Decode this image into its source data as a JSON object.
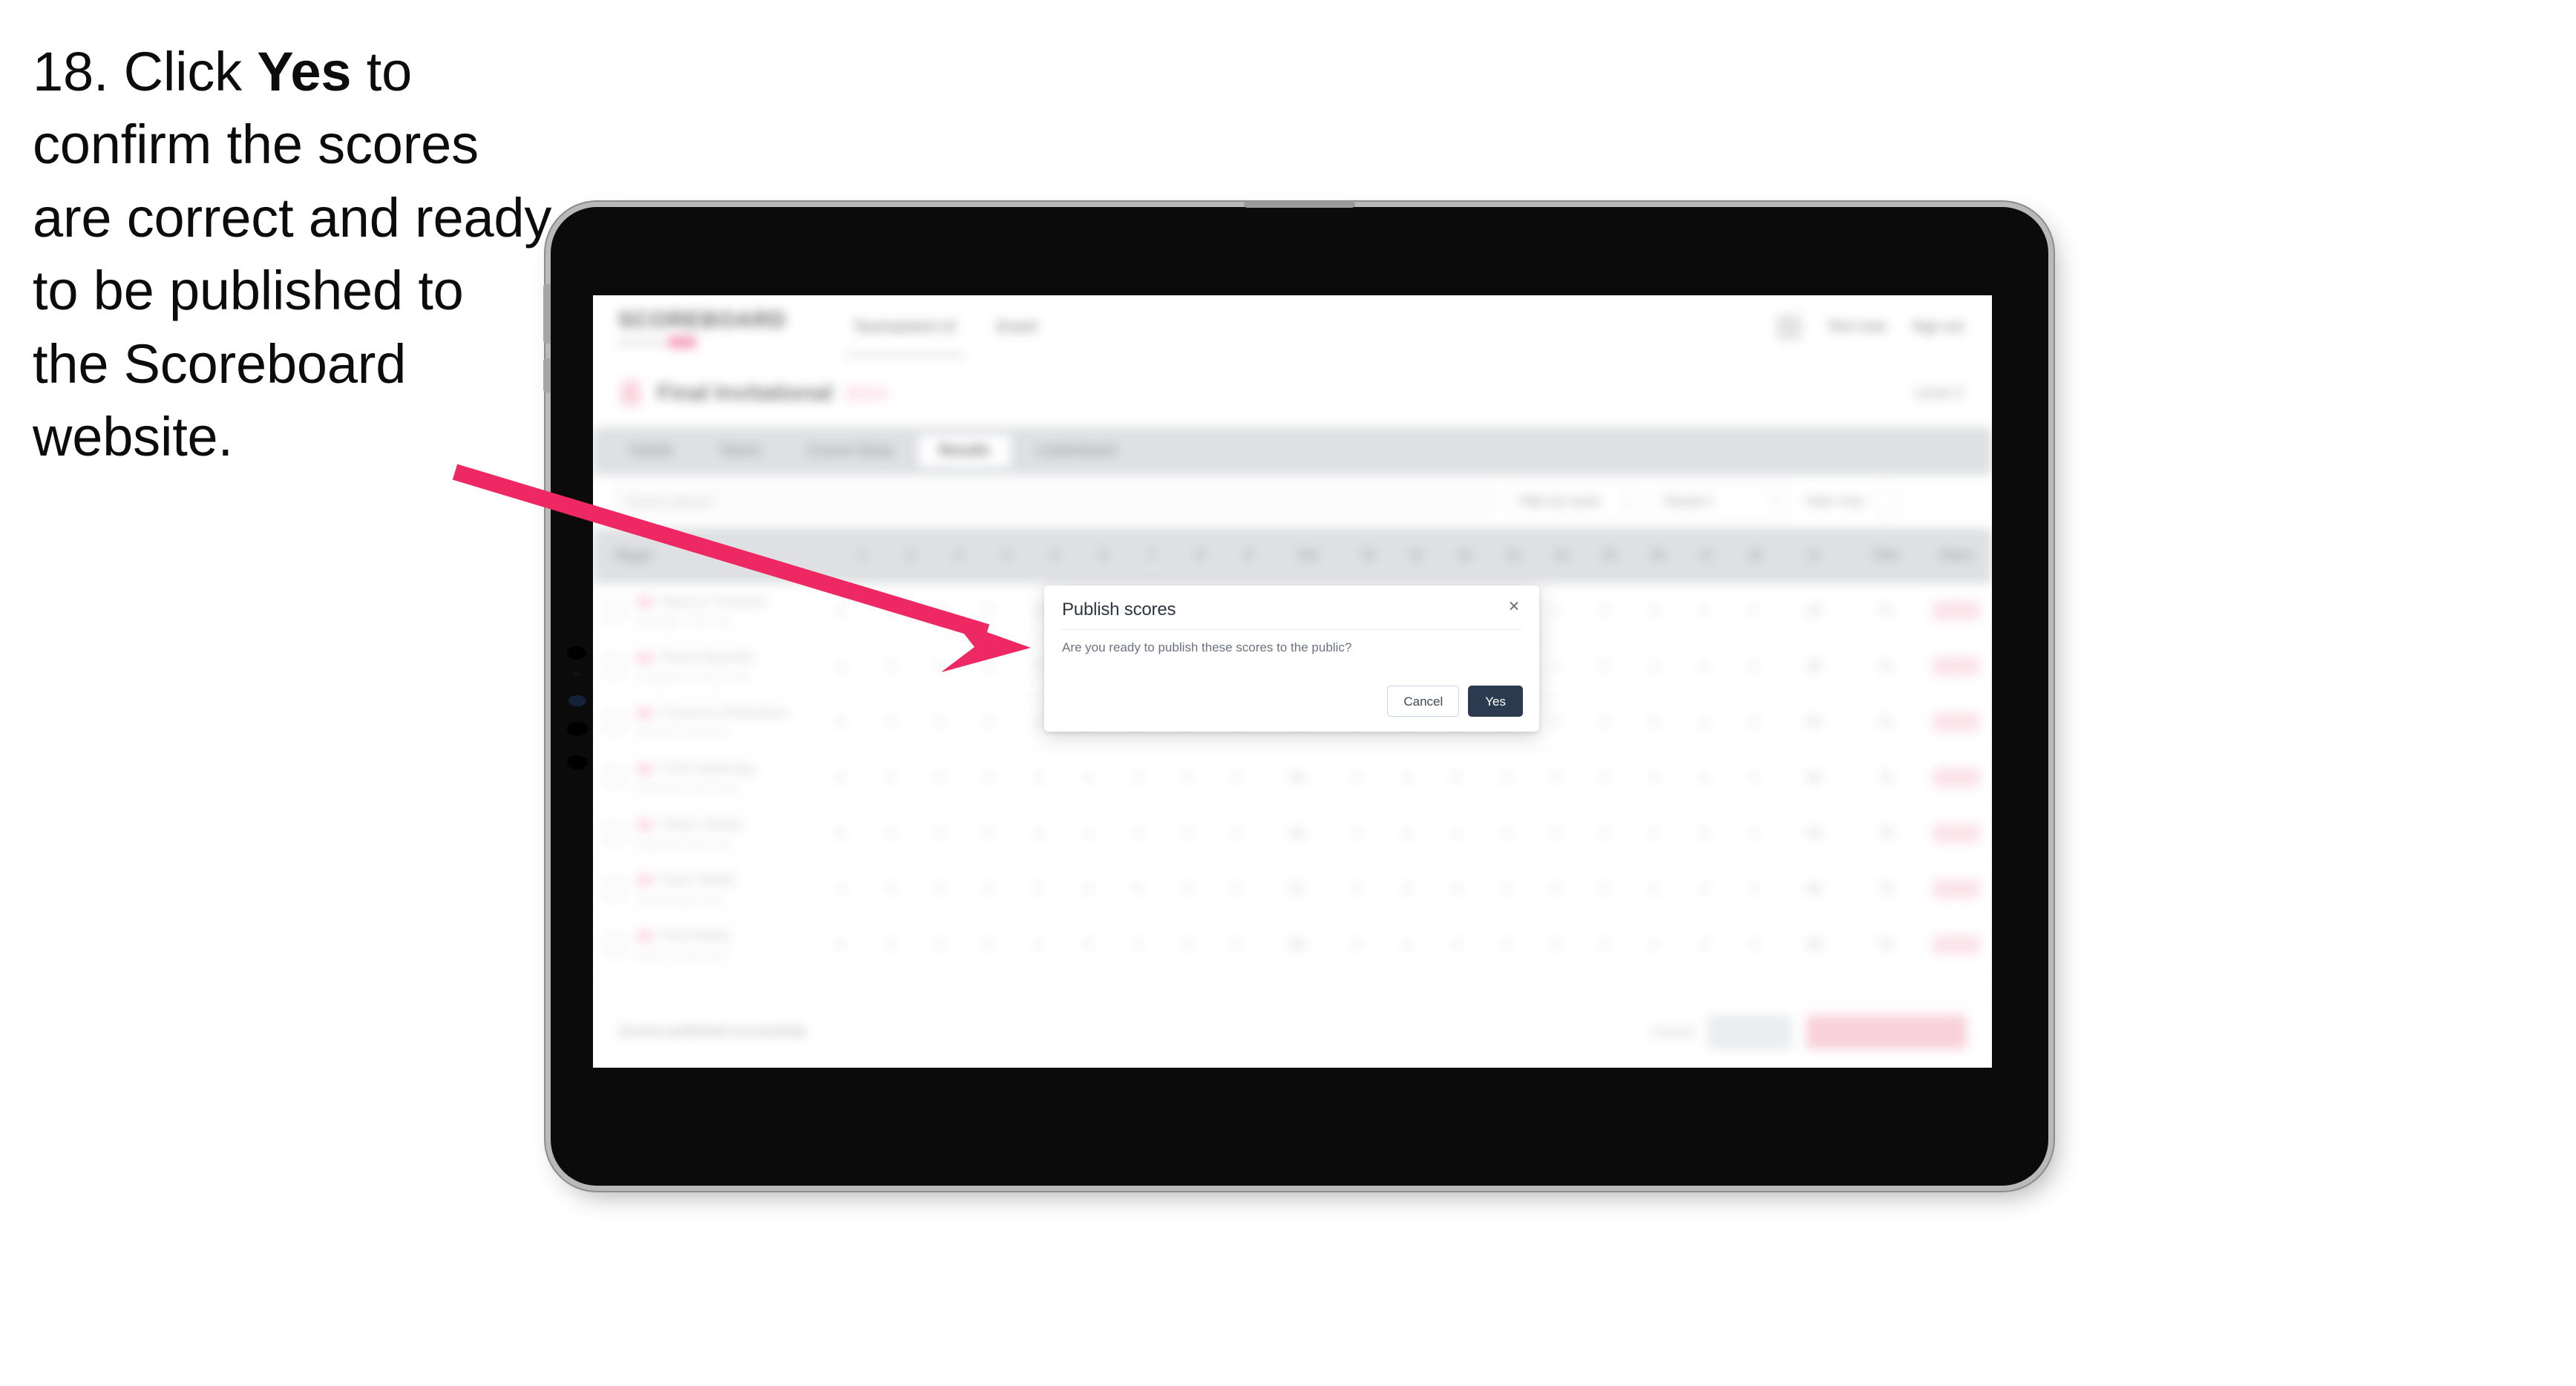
{
  "instruction": {
    "number": "18.",
    "text_before": "Click ",
    "emphasis": "Yes",
    "text_after": " to confirm the scores are correct and ready to be published to the Scoreboard website."
  },
  "colors": {
    "arrow": "#ee2862",
    "primary_button": "#2b3a4f",
    "brand_pink": "#f06292",
    "tab_bar": "#d6d8dc",
    "device_bezel": "#0b0b0b",
    "device_edge": "#b9b9b9"
  },
  "device": {
    "kind": "tablet",
    "orientation": "landscape",
    "keys": [
      "volume-up-key",
      "volume-down-key"
    ]
  },
  "app": {
    "topbar": {
      "logo": "SCOREBOARD",
      "logo_sub": "powered by",
      "logo_pill": "LIVE",
      "nav": [
        {
          "label": "Tournament UI",
          "active": true
        },
        {
          "label": "Event",
          "active": false
        }
      ],
      "right": [
        {
          "label": "Test User",
          "name": "user-menu"
        },
        {
          "label": "Sign out",
          "name": "sign-out-link"
        }
      ]
    },
    "heading": {
      "title": "Final Invitational",
      "year": "2024",
      "right": "Level 3"
    },
    "tabs": [
      {
        "label": "Details",
        "active": false
      },
      {
        "label": "Teams",
        "active": false
      },
      {
        "label": "Course Setup",
        "active": false
      },
      {
        "label": "Results",
        "active": true
      },
      {
        "label": "Leaderboard",
        "active": false
      }
    ],
    "filterbar": {
      "search_placeholder": "Search players",
      "selects": [
        {
          "label": "Filter by round",
          "name": "round-filter-select"
        },
        {
          "label": "Round 1",
          "name": "round-select"
        }
      ],
      "right_text": "Table Only",
      "icon": "columns-icon"
    },
    "table": {
      "columns": [
        "Player",
        "1",
        "2",
        "3",
        "4",
        "5",
        "6",
        "7",
        "8",
        "9",
        "Out",
        "10",
        "11",
        "12",
        "13",
        "14",
        "15",
        "16",
        "17",
        "18",
        "In",
        "Total",
        "Status"
      ],
      "rows": [
        {
          "player": "Marcus Thomton",
          "club": "Oakridge Golf Club",
          "out": "36",
          "in": "35",
          "total": "71",
          "status": "Verified"
        },
        {
          "player": "Elena Reynold",
          "club": "Lakeside Country Club",
          "out": "35",
          "in": "36",
          "total": "71",
          "status": "Verified"
        },
        {
          "player": "Cameron Robertson",
          "club": "Pinehurst National",
          "out": "37",
          "in": "34",
          "total": "71",
          "status": "Verified"
        },
        {
          "player": "Chris Mahoney",
          "club": "Riverbend Golf Links",
          "out": "36",
          "in": "36",
          "total": "72",
          "status": "Verified"
        },
        {
          "player": "Oliver Obrien",
          "club": "Highland Park Golf",
          "out": "38",
          "in": "35",
          "total": "73",
          "status": "Verified"
        },
        {
          "player": "Ryan Webb",
          "club": "Stonebridge Club",
          "out": "37",
          "in": "36",
          "total": "73",
          "status": "Verified"
        },
        {
          "player": "Nick Bailey",
          "club": "Willow Creek Golf",
          "out": "38",
          "in": "36",
          "total": "74",
          "status": "Verified"
        }
      ]
    },
    "actionbar": {
      "note": "Scores published successfully",
      "link": "Cancel",
      "secondary_button": "Save All",
      "primary_button": "Publish scores to public"
    }
  },
  "modal": {
    "title": "Publish scores",
    "body": "Are you ready to publish these scores to the public?",
    "close_label": "×",
    "cancel_label": "Cancel",
    "confirm_label": "Yes"
  }
}
